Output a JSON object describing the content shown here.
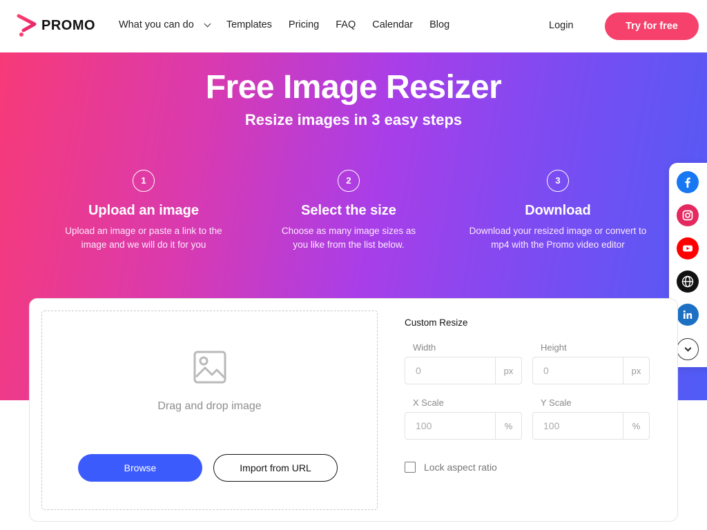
{
  "brand": {
    "name": "PROMO",
    "accent": "#f5416c",
    "primary": "#3b5bfd"
  },
  "nav": {
    "items": [
      {
        "label": "What you can do",
        "has_dropdown": true
      },
      {
        "label": "Templates"
      },
      {
        "label": "Pricing"
      },
      {
        "label": "FAQ"
      },
      {
        "label": "Calendar"
      },
      {
        "label": "Blog"
      }
    ],
    "login_label": "Login",
    "cta_label": "Try for free"
  },
  "hero": {
    "title": "Free Image Resizer",
    "subtitle": "Resize images in 3 easy steps",
    "steps": [
      {
        "number": "1",
        "title": "Upload an image",
        "description": "Upload an image or paste a link to the image and we will do it for you"
      },
      {
        "number": "2",
        "title": "Select the size",
        "description": "Choose as many image sizes as you like from the list below."
      },
      {
        "number": "3",
        "title": "Download",
        "description": "Download your resized image or convert to mp4 with the Promo video editor"
      }
    ]
  },
  "social": {
    "icons": [
      "facebook-icon",
      "instagram-icon",
      "youtube-icon",
      "globe-icon",
      "linkedin-icon",
      "chevron-down-icon"
    ]
  },
  "uploader": {
    "drop_text": "Drag and drop image",
    "browse_label": "Browse",
    "url_label": "Import from URL"
  },
  "custom_resize": {
    "title": "Custom Resize",
    "width": {
      "label": "Width",
      "placeholder": "0",
      "unit": "px"
    },
    "height": {
      "label": "Height",
      "placeholder": "0",
      "unit": "px"
    },
    "x_scale": {
      "label": "X Scale",
      "placeholder": "100",
      "unit": "%"
    },
    "y_scale": {
      "label": "Y Scale",
      "placeholder": "100",
      "unit": "%"
    },
    "lock_label": "Lock aspect ratio",
    "lock_checked": false
  }
}
